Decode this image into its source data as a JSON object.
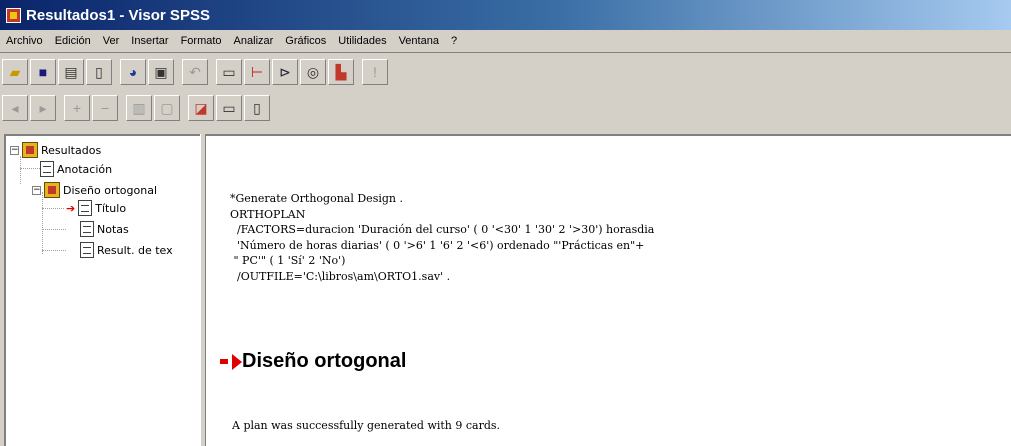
{
  "window": {
    "title": "Resultados1 - Visor SPSS"
  },
  "menu": [
    "Archivo",
    "Edición",
    "Ver",
    "Insertar",
    "Formato",
    "Analizar",
    "Gráficos",
    "Utilidades",
    "Ventana",
    "?"
  ],
  "toolbar1": [
    {
      "icon": "open-folder-icon"
    },
    {
      "icon": "save-icon"
    },
    {
      "icon": "print-icon"
    },
    {
      "icon": "print-preview-icon"
    },
    {
      "icon": "export-icon"
    },
    {
      "icon": "dialog-recall-icon"
    },
    {
      "icon": "undo-icon"
    },
    {
      "icon": "goto-case-icon"
    },
    {
      "icon": "variables-icon"
    },
    {
      "icon": "find-icon"
    },
    {
      "icon": "use-sets-icon"
    },
    {
      "icon": "insert-cases-icon"
    },
    {
      "icon": "run-icon"
    }
  ],
  "toolbar2": [
    {
      "icon": "promote-icon"
    },
    {
      "icon": "demote-icon"
    },
    {
      "icon": "expand-icon"
    },
    {
      "icon": "collapse-icon"
    },
    {
      "icon": "show-icon"
    },
    {
      "icon": "hide-icon"
    },
    {
      "icon": "insert-heading-icon"
    },
    {
      "icon": "insert-title-icon"
    },
    {
      "icon": "insert-text-icon"
    }
  ],
  "tree": {
    "root": "Resultados",
    "items": [
      {
        "label": "Anotación"
      },
      {
        "label": "Diseño ortogonal"
      },
      {
        "label": "Título"
      },
      {
        "label": "Notas"
      },
      {
        "label": "Result. de tex"
      }
    ]
  },
  "output": {
    "syntax_lines": [
      "*Generate Orthogonal Design .",
      "ORTHOPLAN",
      "  /FACTORS=duracion 'Duración del curso' ( 0 '<30' 1 '30' 2 '>30') horasdia",
      "  'Número de horas diarias' ( 0 '>6' 1 '6' 2 '<6') ordenado \"'Prácticas en\"+",
      " \" PC'\" ( 1 'Sí' 2 'No')",
      "  /OUTFILE='C:\\libros\\am\\ORTO1.sav' ."
    ],
    "section_title": "Diseño ortogonal",
    "result_message": "A plan was successfully generated with 9 cards."
  }
}
